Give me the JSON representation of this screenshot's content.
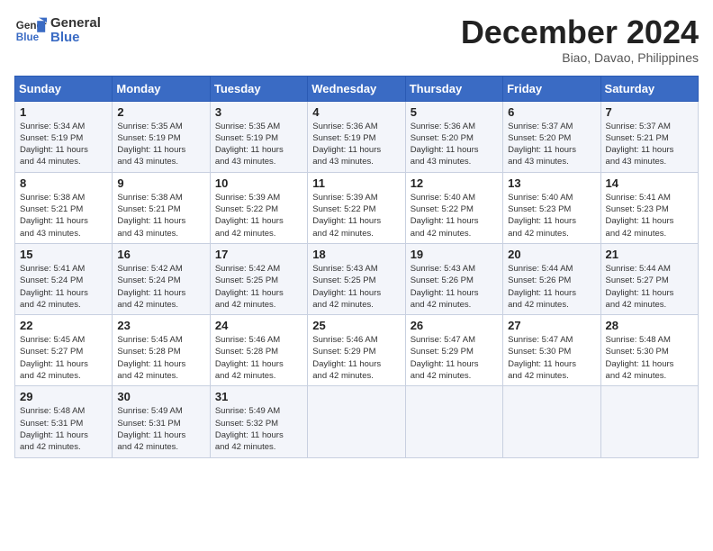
{
  "header": {
    "logo_line1": "General",
    "logo_line2": "Blue",
    "month_year": "December 2024",
    "location": "Biao, Davao, Philippines"
  },
  "days_of_week": [
    "Sunday",
    "Monday",
    "Tuesday",
    "Wednesday",
    "Thursday",
    "Friday",
    "Saturday"
  ],
  "weeks": [
    [
      {
        "day": "1",
        "info": "Sunrise: 5:34 AM\nSunset: 5:19 PM\nDaylight: 11 hours\nand 44 minutes."
      },
      {
        "day": "2",
        "info": "Sunrise: 5:35 AM\nSunset: 5:19 PM\nDaylight: 11 hours\nand 43 minutes."
      },
      {
        "day": "3",
        "info": "Sunrise: 5:35 AM\nSunset: 5:19 PM\nDaylight: 11 hours\nand 43 minutes."
      },
      {
        "day": "4",
        "info": "Sunrise: 5:36 AM\nSunset: 5:19 PM\nDaylight: 11 hours\nand 43 minutes."
      },
      {
        "day": "5",
        "info": "Sunrise: 5:36 AM\nSunset: 5:20 PM\nDaylight: 11 hours\nand 43 minutes."
      },
      {
        "day": "6",
        "info": "Sunrise: 5:37 AM\nSunset: 5:20 PM\nDaylight: 11 hours\nand 43 minutes."
      },
      {
        "day": "7",
        "info": "Sunrise: 5:37 AM\nSunset: 5:21 PM\nDaylight: 11 hours\nand 43 minutes."
      }
    ],
    [
      {
        "day": "8",
        "info": "Sunrise: 5:38 AM\nSunset: 5:21 PM\nDaylight: 11 hours\nand 43 minutes."
      },
      {
        "day": "9",
        "info": "Sunrise: 5:38 AM\nSunset: 5:21 PM\nDaylight: 11 hours\nand 43 minutes."
      },
      {
        "day": "10",
        "info": "Sunrise: 5:39 AM\nSunset: 5:22 PM\nDaylight: 11 hours\nand 42 minutes."
      },
      {
        "day": "11",
        "info": "Sunrise: 5:39 AM\nSunset: 5:22 PM\nDaylight: 11 hours\nand 42 minutes."
      },
      {
        "day": "12",
        "info": "Sunrise: 5:40 AM\nSunset: 5:22 PM\nDaylight: 11 hours\nand 42 minutes."
      },
      {
        "day": "13",
        "info": "Sunrise: 5:40 AM\nSunset: 5:23 PM\nDaylight: 11 hours\nand 42 minutes."
      },
      {
        "day": "14",
        "info": "Sunrise: 5:41 AM\nSunset: 5:23 PM\nDaylight: 11 hours\nand 42 minutes."
      }
    ],
    [
      {
        "day": "15",
        "info": "Sunrise: 5:41 AM\nSunset: 5:24 PM\nDaylight: 11 hours\nand 42 minutes."
      },
      {
        "day": "16",
        "info": "Sunrise: 5:42 AM\nSunset: 5:24 PM\nDaylight: 11 hours\nand 42 minutes."
      },
      {
        "day": "17",
        "info": "Sunrise: 5:42 AM\nSunset: 5:25 PM\nDaylight: 11 hours\nand 42 minutes."
      },
      {
        "day": "18",
        "info": "Sunrise: 5:43 AM\nSunset: 5:25 PM\nDaylight: 11 hours\nand 42 minutes."
      },
      {
        "day": "19",
        "info": "Sunrise: 5:43 AM\nSunset: 5:26 PM\nDaylight: 11 hours\nand 42 minutes."
      },
      {
        "day": "20",
        "info": "Sunrise: 5:44 AM\nSunset: 5:26 PM\nDaylight: 11 hours\nand 42 minutes."
      },
      {
        "day": "21",
        "info": "Sunrise: 5:44 AM\nSunset: 5:27 PM\nDaylight: 11 hours\nand 42 minutes."
      }
    ],
    [
      {
        "day": "22",
        "info": "Sunrise: 5:45 AM\nSunset: 5:27 PM\nDaylight: 11 hours\nand 42 minutes."
      },
      {
        "day": "23",
        "info": "Sunrise: 5:45 AM\nSunset: 5:28 PM\nDaylight: 11 hours\nand 42 minutes."
      },
      {
        "day": "24",
        "info": "Sunrise: 5:46 AM\nSunset: 5:28 PM\nDaylight: 11 hours\nand 42 minutes."
      },
      {
        "day": "25",
        "info": "Sunrise: 5:46 AM\nSunset: 5:29 PM\nDaylight: 11 hours\nand 42 minutes."
      },
      {
        "day": "26",
        "info": "Sunrise: 5:47 AM\nSunset: 5:29 PM\nDaylight: 11 hours\nand 42 minutes."
      },
      {
        "day": "27",
        "info": "Sunrise: 5:47 AM\nSunset: 5:30 PM\nDaylight: 11 hours\nand 42 minutes."
      },
      {
        "day": "28",
        "info": "Sunrise: 5:48 AM\nSunset: 5:30 PM\nDaylight: 11 hours\nand 42 minutes."
      }
    ],
    [
      {
        "day": "29",
        "info": "Sunrise: 5:48 AM\nSunset: 5:31 PM\nDaylight: 11 hours\nand 42 minutes."
      },
      {
        "day": "30",
        "info": "Sunrise: 5:49 AM\nSunset: 5:31 PM\nDaylight: 11 hours\nand 42 minutes."
      },
      {
        "day": "31",
        "info": "Sunrise: 5:49 AM\nSunset: 5:32 PM\nDaylight: 11 hours\nand 42 minutes."
      },
      {
        "day": "",
        "info": ""
      },
      {
        "day": "",
        "info": ""
      },
      {
        "day": "",
        "info": ""
      },
      {
        "day": "",
        "info": ""
      }
    ]
  ]
}
